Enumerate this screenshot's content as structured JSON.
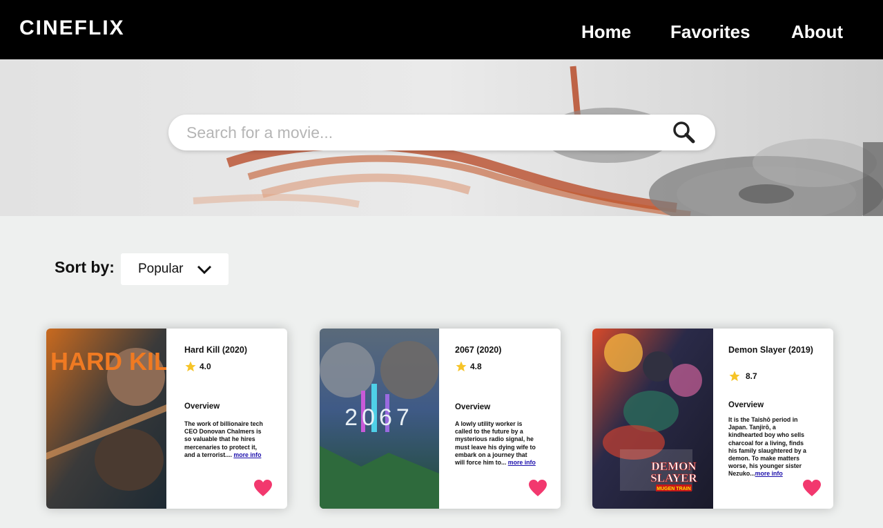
{
  "nav": {
    "brand": "CINEFLIX",
    "links": [
      {
        "label": "Home"
      },
      {
        "label": "Favorites"
      },
      {
        "label": "About"
      }
    ]
  },
  "search": {
    "placeholder": "Search for a movie...",
    "value": ""
  },
  "sort": {
    "label": "Sort by:",
    "selected": "Popular"
  },
  "colors": {
    "navbar": "#000000",
    "page_bg": "#eef0ef",
    "heart": "#f2386e",
    "star": "#f6c428",
    "link": "#1a0dab"
  },
  "movies": [
    {
      "title": "Hard Kill (2020)",
      "rating": "4.0",
      "overview_heading": "Overview",
      "overview": "The work of billionaire tech CEO Donovan Chalmers is so valuable that he hires mercenaries to protect it, and a terrorist.... ",
      "more_info": "more info",
      "poster_text": "HARD KILL",
      "icon": "heart-icon"
    },
    {
      "title": "2067 (2020)",
      "rating": "4.8",
      "overview_heading": "Overview",
      "overview": "A lowly utility worker is called to the future by a mysterious radio signal, he must leave his dying wife to embark on a journey that will force him to... ",
      "more_info": "more info",
      "poster_text": "2067",
      "icon": "heart-icon"
    },
    {
      "title": "Demon Slayer (2019)",
      "rating": "8.7",
      "overview_heading": "Overview",
      "overview": "It is the Taishō period in Japan. Tanjirō, a kindhearted boy who sells charcoal for a living, finds his family slaughtered by a demon. To make matters worse, his younger sister Nezuko...",
      "more_info": "more info",
      "poster_text_1": "DEMON",
      "poster_text_2": "SLAYER",
      "poster_text_3": "MUGEN TRAIN",
      "icon": "heart-icon"
    }
  ]
}
